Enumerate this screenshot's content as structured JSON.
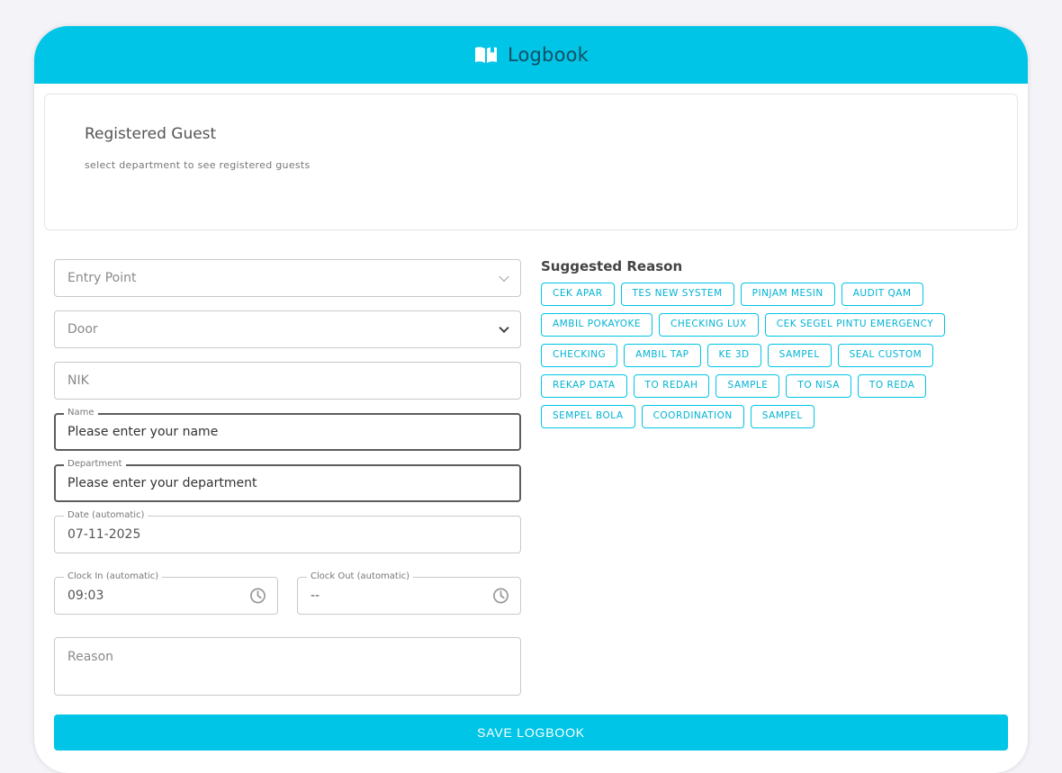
{
  "header": {
    "title": "Logbook",
    "icon": "book-open-icon"
  },
  "registered": {
    "title": "Registered Guest",
    "subtitle": "select department to see registered guests"
  },
  "form": {
    "entry_point": {
      "placeholder": "Entry Point"
    },
    "door": {
      "placeholder": "Door"
    },
    "nik": {
      "placeholder": "NIK"
    },
    "name": {
      "label": "Name",
      "value": "Please enter your name"
    },
    "department": {
      "label": "Department",
      "value": "Please enter your department"
    },
    "date": {
      "label": "Date (automatic)",
      "value": "07-11-2025"
    },
    "clock_in": {
      "label": "Clock In (automatic)",
      "value": "09:03"
    },
    "clock_out": {
      "label": "Clock Out (automatic)",
      "value": "--"
    },
    "reason": {
      "placeholder": "Reason"
    }
  },
  "suggested": {
    "title": "Suggested Reason",
    "chips": [
      "CEK APAR",
      "TES NEW SYSTEM",
      "PINJAM MESIN",
      "AUDIT QAM",
      "AMBIL POKAYOKE",
      "CHECKING LUX",
      "CEK SEGEL PINTU EMERGENCY",
      "CHECKING",
      "AMBIL TAP",
      "KE 3D",
      "SAMPEL",
      "SEAL CUSTOM",
      "REKAP DATA",
      "TO REDAH",
      "SAMPLE",
      "TO NISA",
      "TO REDA",
      "SEMPEL BOLA",
      "COORDINATION",
      "SAMPEL"
    ]
  },
  "save_label": "SAVE LOGBOOK",
  "colors": {
    "accent": "#00c5e6",
    "header_text": "#134f66",
    "background": "#f3f3f8"
  }
}
